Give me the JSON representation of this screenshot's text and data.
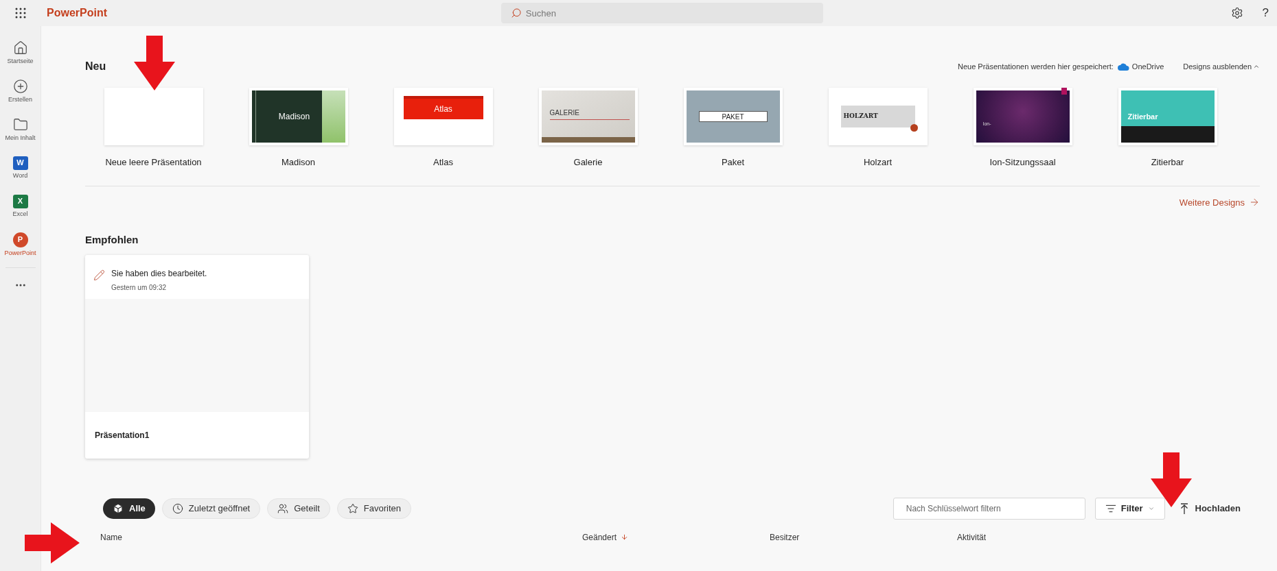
{
  "app_bar": {
    "title": "PowerPoint",
    "search": {
      "placeholder": "Suchen"
    },
    "help": "?"
  },
  "sidebar": {
    "items": [
      {
        "label": "Startseite",
        "kind": "home",
        "selected": false
      },
      {
        "label": "Erstellen",
        "kind": "create",
        "selected": false
      },
      {
        "label": "Mein Inhalt",
        "kind": "folder",
        "selected": false
      },
      {
        "label": "Word",
        "kind": "word",
        "glyph": "W",
        "selected": false
      },
      {
        "label": "Excel",
        "kind": "excel",
        "glyph": "X",
        "selected": false
      },
      {
        "label": "PowerPoint",
        "kind": "powerpoint",
        "glyph": "P",
        "selected": true
      }
    ]
  },
  "new": {
    "title": "Neu",
    "save_note": "Neue Präsentationen werden hier gespeichert:",
    "save_location": "OneDrive",
    "toggle": "Designs ausblenden",
    "templates": [
      {
        "name": "Neue leere Präsentation",
        "kind": "blank"
      },
      {
        "name": "Madison",
        "kind": "madison",
        "thumb_text": "Madison"
      },
      {
        "name": "Atlas",
        "kind": "atlas",
        "thumb_text": "Atlas"
      },
      {
        "name": "Galerie",
        "kind": "galerie",
        "thumb_text": "GALERIE"
      },
      {
        "name": "Paket",
        "kind": "paket",
        "thumb_text": "PAKET"
      },
      {
        "name": "Holzart",
        "kind": "holzart",
        "thumb_text": "HOLZART"
      },
      {
        "name": "Ion-Sitzungssaal",
        "kind": "ion",
        "thumb_text": "Ion-"
      },
      {
        "name": "Zitierbar",
        "kind": "zitierbar",
        "thumb_text": "Zitierbar"
      }
    ],
    "more": "Weitere Designs"
  },
  "recommended": {
    "title": "Empfohlen",
    "cards": [
      {
        "activity": "Sie haben dies bearbeitet.",
        "time": "Gestern um 09:32",
        "file": "Präsentation1"
      }
    ]
  },
  "files": {
    "pills": [
      {
        "label": "Alle",
        "kind": "all",
        "selected": true
      },
      {
        "label": "Zuletzt geöffnet",
        "kind": "recent",
        "selected": false
      },
      {
        "label": "Geteilt",
        "kind": "shared",
        "selected": false
      },
      {
        "label": "Favoriten",
        "kind": "favorites",
        "selected": false
      }
    ],
    "filter_field": {
      "placeholder": "Nach Schlüsselwort filtern"
    },
    "filter_button": "Filter",
    "upload": "Hochladen",
    "columns": [
      {
        "label": "Name",
        "sorted": false
      },
      {
        "label": "Geändert",
        "sorted": true
      },
      {
        "label": "Besitzer",
        "sorted": false
      },
      {
        "label": "Aktivität",
        "sorted": false
      }
    ]
  }
}
